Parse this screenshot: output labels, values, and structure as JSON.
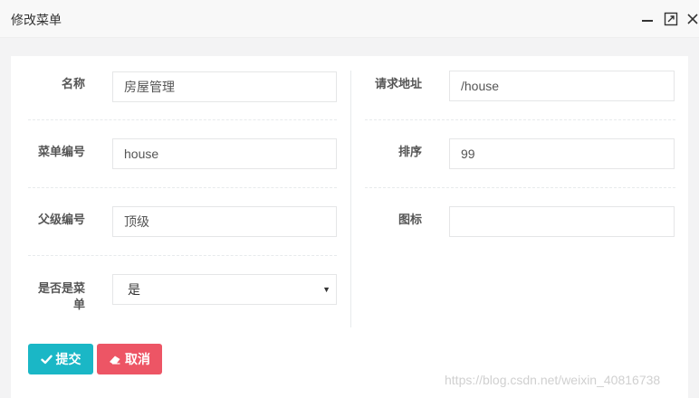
{
  "window": {
    "title": "修改菜单",
    "controls": [
      "minimize-icon",
      "maximize-icon",
      "close-icon"
    ]
  },
  "form": {
    "left": {
      "name": {
        "label": "名称",
        "value": "房屋管理"
      },
      "menu_code": {
        "label": "菜单编号",
        "value": "house"
      },
      "parent_code": {
        "label": "父级编号",
        "value": "顶级"
      },
      "is_menu": {
        "label_line1": "是否是菜",
        "label_line2": "单",
        "value": "是"
      }
    },
    "right": {
      "url": {
        "label": "请求地址",
        "value": "/house"
      },
      "sort": {
        "label": "排序",
        "value": "99"
      },
      "icon": {
        "label": "图标",
        "value": ""
      }
    }
  },
  "buttons": {
    "submit_label": "提交",
    "cancel_label": "取消"
  },
  "watermark": "https://blog.csdn.net/weixin_40816738",
  "colors": {
    "submit": "#1ab7c6",
    "cancel": "#ed5565"
  }
}
